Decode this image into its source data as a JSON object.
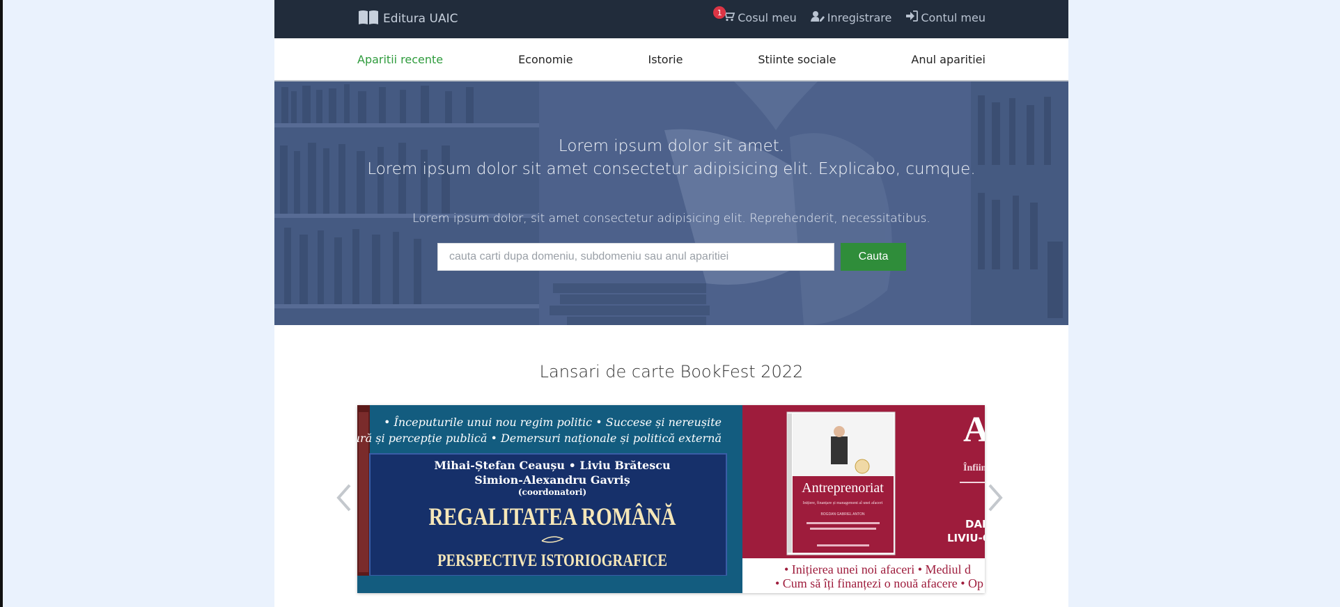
{
  "brand": {
    "name": "Editura UAIC"
  },
  "topnav": {
    "cart_label": "Cosul meu",
    "cart_count": "1",
    "register_label": "Inregistrare",
    "account_label": "Contul meu"
  },
  "categories": [
    {
      "label": "Aparitii recente",
      "active": true
    },
    {
      "label": "Economie"
    },
    {
      "label": "Istorie"
    },
    {
      "label": "Stiinte sociale"
    },
    {
      "label": "Anul aparitiei"
    }
  ],
  "hero": {
    "line1": "Lorem ipsum dolor sit amet.",
    "line2": "Lorem ipsum dolor sit amet consectetur adipisicing elit. Explicabo, cumque.",
    "subtitle": "Lorem ipsum dolor, sit amet consectetur adipisicing elit. Reprehenderit, necessitatibus.",
    "search_placeholder": "cauta carti dupa domeniu, subdomeniu sau anul aparitiei",
    "search_button": "Cauta"
  },
  "section": {
    "title": "Lansari de carte BookFest 2022"
  },
  "slides": [
    {
      "bullets1": "• Începuturile unui nou regim politic • Succese și nereușite",
      "bullets2": "• Cultură și percepție publică • Demersuri naționale și politică externă",
      "authors1": "Mihai-Ștefan Ceaușu  •  Liviu Brătescu",
      "authors2": "Simion-Alexandru Gavriș",
      "coord": "(coordonatori)",
      "title1": "REGALITATEA ROMÂNĂ",
      "title2": "PERSPECTIVE ISTORIOGRAFICE"
    },
    {
      "book_title": "Antreprenoriat",
      "book_subtitle": "Inițiere, finanțare și management al unei afaceri",
      "author": "BOGDAN GABRIEL ANTON",
      "partial_right": "Ar",
      "partial_sub": "Înființ",
      "partial_names1": "DAN",
      "partial_names2": "LIVIU-G",
      "bullets1": "• Inițierea unei noi afaceri • Mediul d",
      "bullets2": "• Cum să îți finanțezi o nouă afacere • Op"
    }
  ],
  "colors": {
    "topbar": "#212c3b",
    "accent_green": "#2e9b3c",
    "button_green": "#2f8d3a",
    "hero_overlay": "#4d6288"
  }
}
